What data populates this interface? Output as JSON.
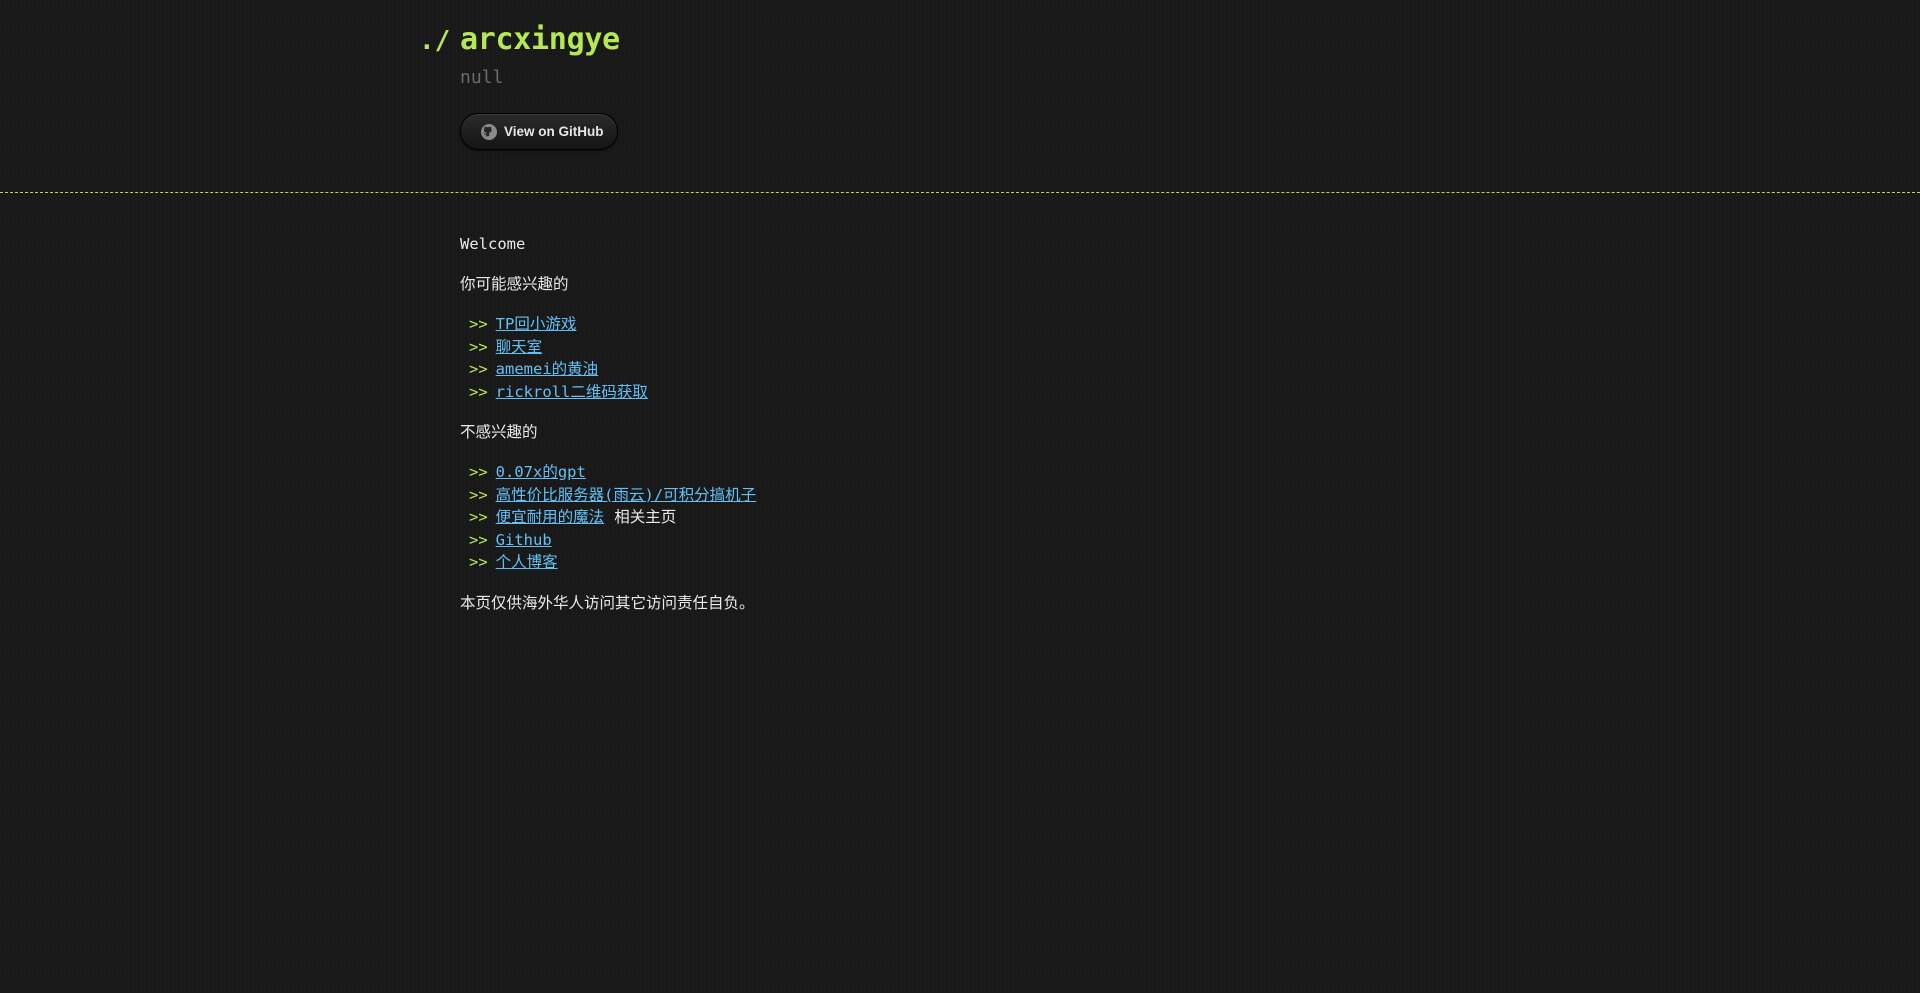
{
  "header": {
    "prompt": "./",
    "title": "arcxingye",
    "tagline": "null",
    "github_button": {
      "label": "View on GitHub",
      "icon": "github-icon"
    }
  },
  "main": {
    "welcome": "Welcome",
    "interested_heading": "你可能感兴趣的",
    "bullet": ">>",
    "interested_links": [
      {
        "label": "TP回小游戏"
      },
      {
        "label": "聊天室"
      },
      {
        "label": "amemei的黄油"
      },
      {
        "label": "rickroll二维码获取"
      }
    ],
    "not_interested_heading": "不感兴趣的",
    "not_interested_links": [
      {
        "label": "0.07x的gpt",
        "suffix": ""
      },
      {
        "label": "高性价比服务器(雨云)/可积分搞机子",
        "suffix": ""
      },
      {
        "label": "便宜耐用的魔法",
        "suffix": "相关主页"
      },
      {
        "label": "Github",
        "suffix": ""
      },
      {
        "label": "个人博客",
        "suffix": ""
      }
    ],
    "footer_note": "本页仅供海外华人访问其它访问责任自负。"
  },
  "colors": {
    "background": "#191919",
    "accent": "#b5e853",
    "link": "#63c0f5",
    "muted": "#6b6b6b",
    "divider": "#c7d35a"
  }
}
